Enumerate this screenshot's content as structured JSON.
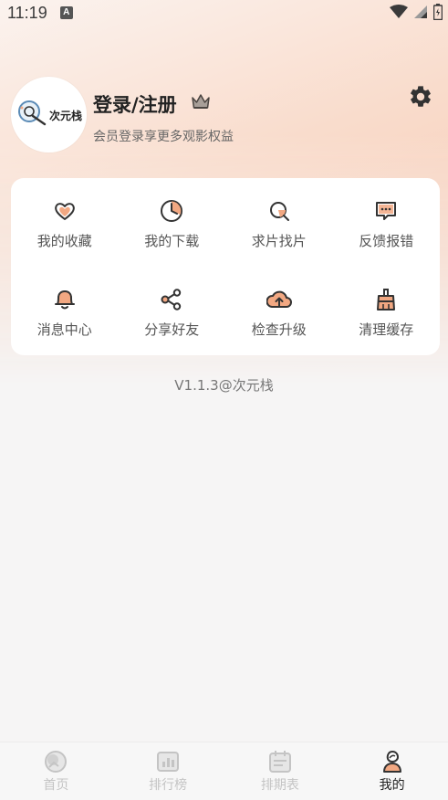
{
  "status_bar": {
    "time": "11:19",
    "notification_letter": "A"
  },
  "profile": {
    "avatar_text": "次元栈",
    "login_title": "登录/注册",
    "login_subtitle": "会员登录享更多观影权益"
  },
  "menu": {
    "items": [
      {
        "label": "我的收藏",
        "icon": "heart-icon"
      },
      {
        "label": "我的下载",
        "icon": "download-pie-icon"
      },
      {
        "label": "求片找片",
        "icon": "search-film-icon"
      },
      {
        "label": "反馈报错",
        "icon": "feedback-icon"
      },
      {
        "label": "消息中心",
        "icon": "bell-icon"
      },
      {
        "label": "分享好友",
        "icon": "share-icon"
      },
      {
        "label": "检查升级",
        "icon": "cloud-upload-icon"
      },
      {
        "label": "清理缓存",
        "icon": "broom-icon"
      }
    ]
  },
  "version_text": "V1.1.3@次元栈",
  "tabbar": {
    "items": [
      {
        "label": "首页",
        "icon": "home-icon",
        "active": false
      },
      {
        "label": "排行榜",
        "icon": "chart-icon",
        "active": false
      },
      {
        "label": "排期表",
        "icon": "calendar-icon",
        "active": false
      },
      {
        "label": "我的",
        "icon": "profile-icon",
        "active": true
      }
    ]
  },
  "colors": {
    "accent": "#f2a882",
    "accent_dark": "#333333",
    "inactive_tab": "#c4c4c4"
  }
}
